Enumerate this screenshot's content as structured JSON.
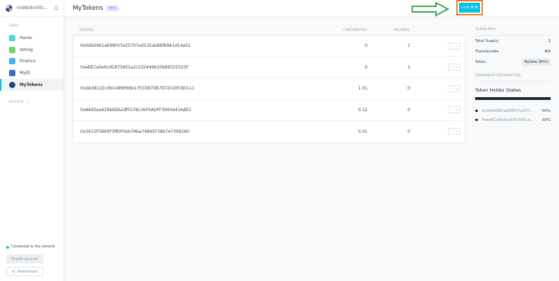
{
  "account": {
    "address": "0x9809c05fc..."
  },
  "sidebar": {
    "apps_title": "APPS",
    "items": [
      {
        "label": "Home",
        "icon": "home-icon",
        "color": "#58d0e6"
      },
      {
        "label": "Voting",
        "icon": "voting-icon",
        "color": "#6fd36a"
      },
      {
        "label": "Finance",
        "icon": "finance-icon",
        "color": "#3ab6ea"
      },
      {
        "label": "MyID",
        "icon": "id-icon",
        "color": "#3870c8"
      },
      {
        "label": "MyTokens",
        "icon": "tokens-icon",
        "color": "#1c4a7e"
      }
    ],
    "system_title": "SYSTEM",
    "network_status": "Connected to the network",
    "enable_account": "Enable account",
    "preferences": "Preferences"
  },
  "header": {
    "title": "MyTokens",
    "badge": "MYV",
    "lock_button": "Lock MYB"
  },
  "table": {
    "headers": {
      "holder": "HOLDER",
      "contributes": "CONTRIBUTES",
      "balance": "BALANCE"
    },
    "rows": [
      {
        "holder": "0x0db0961aE68F07e25707ed132abB6fb9A1d14a51",
        "contributes": "0",
        "balance": "1"
      },
      {
        "holder": "0xebECa0e9cdC873d51a2c232449b10b89525323F",
        "contributes": "0",
        "balance": "1"
      },
      {
        "holder": "0x2A3B11Ec3bC496E66b17E1D870B7D72Cd3CB0111",
        "contributes": "1.01",
        "balance": "0"
      },
      {
        "holder": "0x8492ea429b6Db2df0178c36F0ADFF3093e416dE3",
        "contributes": "0.12",
        "balance": "0"
      },
      {
        "holder": "0x3415F5800F3fB0FbdcFAba74895F39b747306260",
        "contributes": "0.01",
        "balance": "0"
      }
    ],
    "menu_label": "···"
  },
  "panel": {
    "token_info_title": "TOKEN INFO",
    "total_supply_label": "Total Supply",
    "total_supply": "2",
    "transferable_label": "Transferable",
    "transferable": "NO",
    "token_label": "Token",
    "token": "MyVote (MYV)",
    "ownership_title": "OWNERSHIP DISTRIBUTION",
    "stakes_label": "Token Holder Stakes",
    "holders": [
      {
        "address": "0x0db0961aE68F07e257...",
        "pct": "50%"
      },
      {
        "address": "0xebECa0e9cdC873d51a...",
        "pct": "50%"
      }
    ]
  },
  "colors": {
    "accent": "#08bee5",
    "highlight": "#f07a22",
    "arrow": "#3aa84a"
  }
}
